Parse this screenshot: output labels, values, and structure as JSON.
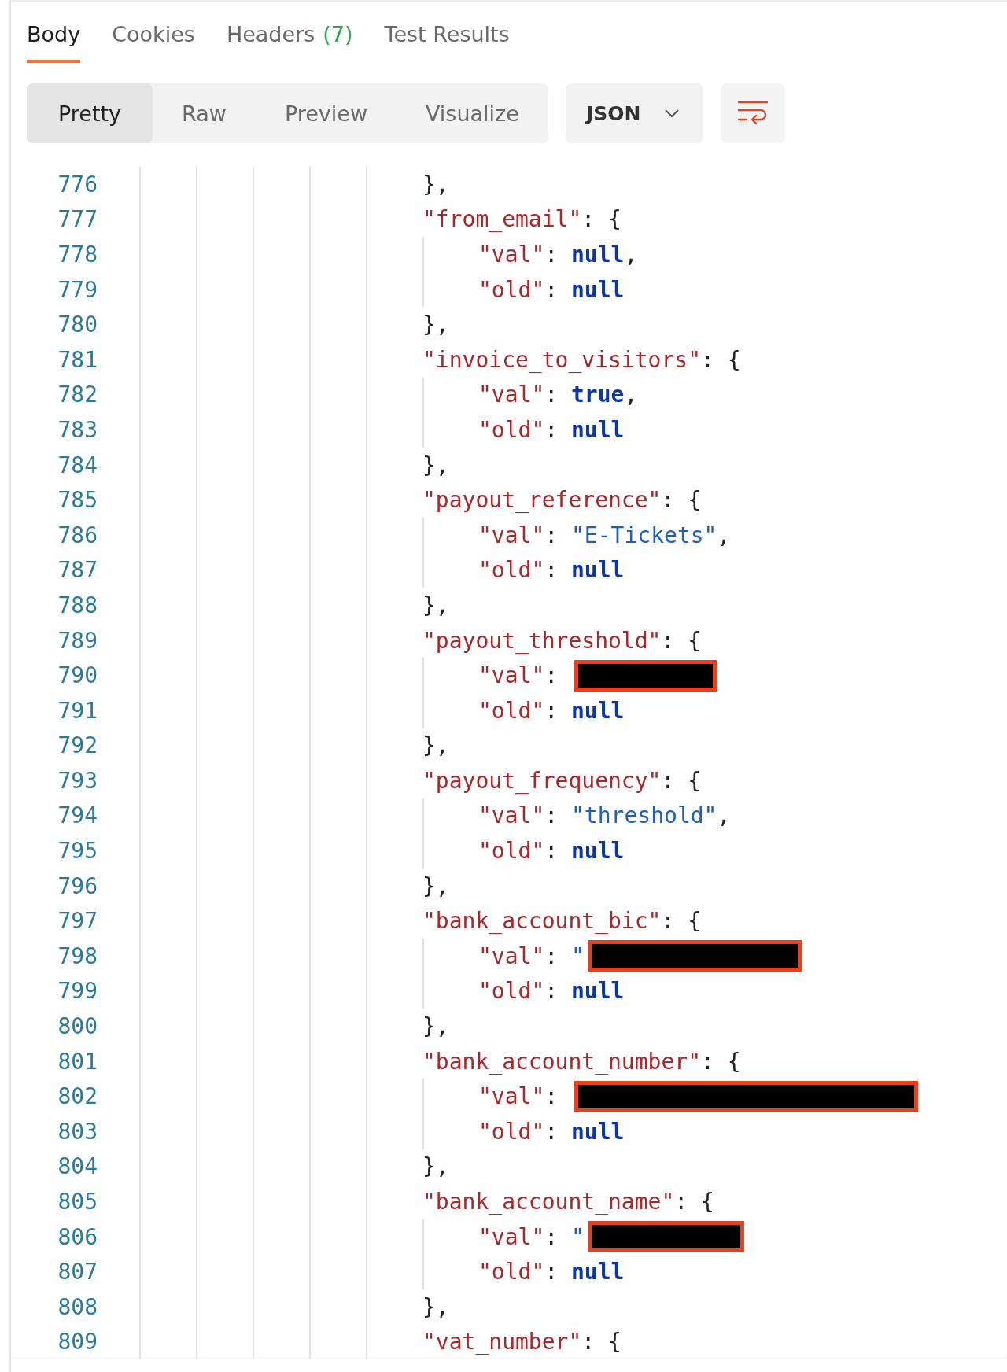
{
  "tabs": [
    {
      "label": "Body",
      "selected": true
    },
    {
      "label": "Cookies",
      "selected": false
    },
    {
      "label": "Headers",
      "count": "(7)",
      "selected": false
    },
    {
      "label": "Test Results",
      "selected": false
    }
  ],
  "view_modes": [
    {
      "label": "Pretty",
      "selected": true
    },
    {
      "label": "Raw",
      "selected": false
    },
    {
      "label": "Preview",
      "selected": false
    },
    {
      "label": "Visualize",
      "selected": false
    }
  ],
  "format_dropdown": {
    "value": "JSON"
  },
  "code": {
    "entries": [
      {
        "line": "776",
        "tokens": [
          {
            "kind": "punct",
            "text": "},"
          }
        ]
      },
      {
        "line": "777",
        "tokens": [
          {
            "kind": "key",
            "text": "\"from_email\""
          },
          {
            "kind": "punct",
            "text": ": {"
          }
        ],
        "children": [
          {
            "line": "778",
            "tokens": [
              {
                "kind": "key",
                "text": "\"val\""
              },
              {
                "kind": "punct",
                "text": ": "
              },
              {
                "kind": "keyword",
                "text": "null"
              },
              {
                "kind": "punct",
                "text": ","
              }
            ]
          },
          {
            "line": "779",
            "tokens": [
              {
                "kind": "key",
                "text": "\"old\""
              },
              {
                "kind": "punct",
                "text": ": "
              },
              {
                "kind": "keyword",
                "text": "null"
              }
            ]
          }
        ]
      },
      {
        "line": "780",
        "tokens": [
          {
            "kind": "punct",
            "text": "},"
          }
        ]
      },
      {
        "line": "781",
        "tokens": [
          {
            "kind": "key",
            "text": "\"invoice_to_visitors\""
          },
          {
            "kind": "punct",
            "text": ": {"
          }
        ],
        "children": [
          {
            "line": "782",
            "tokens": [
              {
                "kind": "key",
                "text": "\"val\""
              },
              {
                "kind": "punct",
                "text": ": "
              },
              {
                "kind": "keyword",
                "text": "true"
              },
              {
                "kind": "punct",
                "text": ","
              }
            ]
          },
          {
            "line": "783",
            "tokens": [
              {
                "kind": "key",
                "text": "\"old\""
              },
              {
                "kind": "punct",
                "text": ": "
              },
              {
                "kind": "keyword",
                "text": "null"
              }
            ]
          }
        ]
      },
      {
        "line": "784",
        "tokens": [
          {
            "kind": "punct",
            "text": "},"
          }
        ]
      },
      {
        "line": "785",
        "tokens": [
          {
            "kind": "key",
            "text": "\"payout_reference\""
          },
          {
            "kind": "punct",
            "text": ": {"
          }
        ],
        "children": [
          {
            "line": "786",
            "tokens": [
              {
                "kind": "key",
                "text": "\"val\""
              },
              {
                "kind": "punct",
                "text": ": "
              },
              {
                "kind": "string",
                "text": "\"E-Tickets\""
              },
              {
                "kind": "punct",
                "text": ","
              }
            ]
          },
          {
            "line": "787",
            "tokens": [
              {
                "kind": "key",
                "text": "\"old\""
              },
              {
                "kind": "punct",
                "text": ": "
              },
              {
                "kind": "keyword",
                "text": "null"
              }
            ]
          }
        ]
      },
      {
        "line": "788",
        "tokens": [
          {
            "kind": "punct",
            "text": "},"
          }
        ]
      },
      {
        "line": "789",
        "tokens": [
          {
            "kind": "key",
            "text": "\"payout_threshold\""
          },
          {
            "kind": "punct",
            "text": ": {"
          }
        ],
        "children": [
          {
            "line": "790",
            "tokens": [
              {
                "kind": "key",
                "text": "\"val\""
              },
              {
                "kind": "punct",
                "text": ": "
              },
              {
                "kind": "redacted"
              }
            ]
          },
          {
            "line": "791",
            "tokens": [
              {
                "kind": "key",
                "text": "\"old\""
              },
              {
                "kind": "punct",
                "text": ": "
              },
              {
                "kind": "keyword",
                "text": "null"
              }
            ]
          }
        ]
      },
      {
        "line": "792",
        "tokens": [
          {
            "kind": "punct",
            "text": "},"
          }
        ]
      },
      {
        "line": "793",
        "tokens": [
          {
            "kind": "key",
            "text": "\"payout_frequency\""
          },
          {
            "kind": "punct",
            "text": ": {"
          }
        ],
        "children": [
          {
            "line": "794",
            "tokens": [
              {
                "kind": "key",
                "text": "\"val\""
              },
              {
                "kind": "punct",
                "text": ": "
              },
              {
                "kind": "string",
                "text": "\"threshold\""
              },
              {
                "kind": "punct",
                "text": ","
              }
            ]
          },
          {
            "line": "795",
            "tokens": [
              {
                "kind": "key",
                "text": "\"old\""
              },
              {
                "kind": "punct",
                "text": ": "
              },
              {
                "kind": "keyword",
                "text": "null"
              }
            ]
          }
        ]
      },
      {
        "line": "796",
        "tokens": [
          {
            "kind": "punct",
            "text": "},"
          }
        ]
      },
      {
        "line": "797",
        "tokens": [
          {
            "kind": "key",
            "text": "\"bank_account_bic\""
          },
          {
            "kind": "punct",
            "text": ": {"
          }
        ],
        "children": [
          {
            "line": "798",
            "tokens": [
              {
                "kind": "key",
                "text": "\"val\""
              },
              {
                "kind": "punct",
                "text": ": "
              },
              {
                "kind": "string",
                "text": "\""
              },
              {
                "kind": "redacted"
              }
            ]
          },
          {
            "line": "799",
            "tokens": [
              {
                "kind": "key",
                "text": "\"old\""
              },
              {
                "kind": "punct",
                "text": ": "
              },
              {
                "kind": "keyword",
                "text": "null"
              }
            ]
          }
        ]
      },
      {
        "line": "800",
        "tokens": [
          {
            "kind": "punct",
            "text": "},"
          }
        ]
      },
      {
        "line": "801",
        "tokens": [
          {
            "kind": "key",
            "text": "\"bank_account_number\""
          },
          {
            "kind": "punct",
            "text": ": {"
          }
        ],
        "children": [
          {
            "line": "802",
            "tokens": [
              {
                "kind": "key",
                "text": "\"val\""
              },
              {
                "kind": "punct",
                "text": ": "
              },
              {
                "kind": "redacted"
              }
            ]
          },
          {
            "line": "803",
            "tokens": [
              {
                "kind": "key",
                "text": "\"old\""
              },
              {
                "kind": "punct",
                "text": ": "
              },
              {
                "kind": "keyword",
                "text": "null"
              }
            ]
          }
        ]
      },
      {
        "line": "804",
        "tokens": [
          {
            "kind": "punct",
            "text": "},"
          }
        ]
      },
      {
        "line": "805",
        "tokens": [
          {
            "kind": "key",
            "text": "\"bank_account_name\""
          },
          {
            "kind": "punct",
            "text": ": {"
          }
        ],
        "children": [
          {
            "line": "806",
            "tokens": [
              {
                "kind": "key",
                "text": "\"val\""
              },
              {
                "kind": "punct",
                "text": ": "
              },
              {
                "kind": "string",
                "text": "\""
              },
              {
                "kind": "redacted"
              }
            ]
          },
          {
            "line": "807",
            "tokens": [
              {
                "kind": "key",
                "text": "\"old\""
              },
              {
                "kind": "punct",
                "text": ": "
              },
              {
                "kind": "keyword",
                "text": "null"
              }
            ]
          }
        ]
      },
      {
        "line": "808",
        "tokens": [
          {
            "kind": "punct",
            "text": "},"
          }
        ]
      },
      {
        "line": "809",
        "tokens": [
          {
            "kind": "key",
            "text": "\"vat_number\""
          },
          {
            "kind": "punct",
            "text": ": {"
          }
        ]
      }
    ]
  }
}
